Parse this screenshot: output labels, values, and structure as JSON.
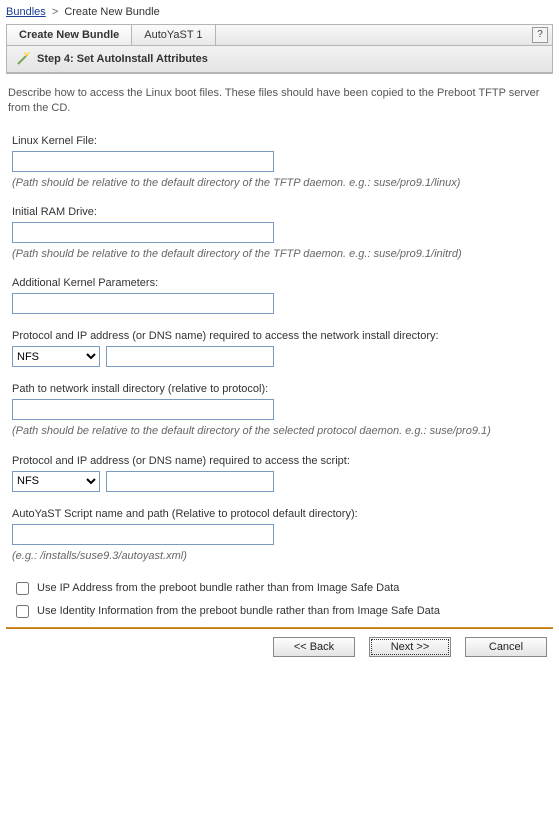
{
  "breadcrumb": {
    "root": "Bundles",
    "current": "Create New Bundle"
  },
  "tabs": {
    "tab1": "Create New Bundle",
    "tab2": "AutoYaST 1"
  },
  "step_title": "Step 4: Set AutoInstall Attributes",
  "description": "Describe how to access the Linux boot files. These files should have been copied to the Preboot TFTP server from the CD.",
  "fields": {
    "kernel": {
      "label": "Linux Kernel File:",
      "value": "",
      "hint": "(Path should be relative to the default directory of the TFTP daemon. e.g.: suse/pro9.1/linux)"
    },
    "ram": {
      "label": "Initial RAM Drive:",
      "value": "",
      "hint": "(Path should be relative to the default directory of the TFTP daemon. e.g.: suse/pro9.1/initrd)"
    },
    "params": {
      "label": "Additional Kernel Parameters:",
      "value": ""
    },
    "netinstall": {
      "label": "Protocol and IP address (or DNS name) required to access the network install directory:",
      "protocol": "NFS",
      "address": ""
    },
    "netpath": {
      "label": "Path to network install directory (relative to protocol):",
      "value": "",
      "hint": "(Path should be relative to the default directory of the selected protocol daemon. e.g.: suse/pro9.1)"
    },
    "script_access": {
      "label": "Protocol and IP address (or DNS name) required to access the script:",
      "protocol": "NFS",
      "address": ""
    },
    "script_name": {
      "label": "AutoYaST Script name and path (Relative to protocol default directory):",
      "value": "",
      "hint": "(e.g.: /installs/suse9.3/autoyast.xml)"
    }
  },
  "checks": {
    "ip_bundle": "Use IP Address from the preboot bundle rather than from Image Safe Data",
    "identity_bundle": "Use Identity Information from the preboot bundle rather than from Image Safe Data"
  },
  "buttons": {
    "back": "<< Back",
    "next": "Next >>",
    "cancel": "Cancel"
  },
  "protocol_options": [
    "NFS"
  ]
}
